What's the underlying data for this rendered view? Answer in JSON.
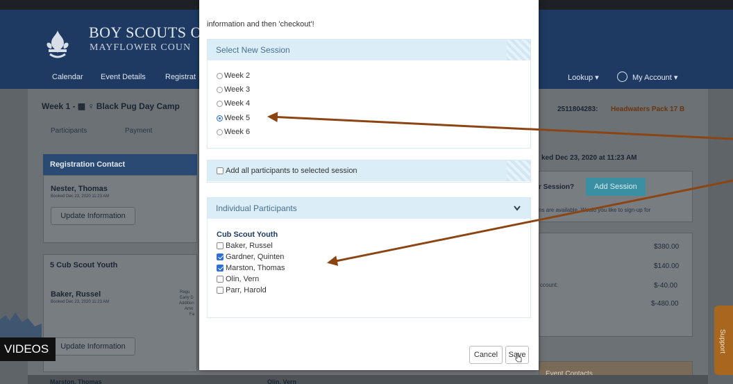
{
  "background_page": {
    "brand": {
      "line1": "BOY SCOUTS O",
      "line2": "MAYFLOWER COUN"
    },
    "nav": [
      "Calendar",
      "Event Details",
      "Registrat"
    ],
    "nav_right": {
      "lookup": "Lookup ▾",
      "account": "My Account ▾"
    },
    "event_title": "Week 1 - ▦ ♀ Black Pug Day Camp",
    "event_ref": "2511804283:",
    "event_ref_name": "Headwaters Pack 17 B",
    "tabs": [
      "Participants",
      "Payment"
    ],
    "registration_contact": {
      "heading": "Registration Contact",
      "name": "Nester, Thomas",
      "booked": "Booked Dec 23, 2020 11:23 AM",
      "update_button": "Update Information"
    },
    "booked_text": "ked Dec 23, 2020 at 11:23 AM",
    "session_question": "r Session?",
    "add_session_button": "Add Session",
    "available_text": "ns are available. Would you like to sign-up for",
    "youth_panel": {
      "heading": "5 Cub Scout Youth",
      "name": "Baker, Russel",
      "booked": "Booked Dec 23, 2020 11:23 AM",
      "fee_labels": [
        "Regu",
        "Early D",
        "Addition",
        "Amo",
        "Fa"
      ],
      "update_button": "Update Information"
    },
    "prices": [
      "$380.00",
      "$140.00",
      "$-40.00",
      "$-480.00"
    ],
    "discount_label": "ccount:",
    "event_contacts": "Event Contacts",
    "bottom_names": [
      "Marston, Thomas",
      "Olin, Vern"
    ],
    "videos_label": "VIDEOS",
    "support_label": "Support"
  },
  "modal": {
    "intro": "information and then 'checkout'!",
    "select_session": {
      "heading": "Select New Session",
      "options": [
        {
          "label": "Week 2",
          "selected": false
        },
        {
          "label": "Week 3",
          "selected": false
        },
        {
          "label": "Week 4",
          "selected": false
        },
        {
          "label": "Week 5",
          "selected": true
        },
        {
          "label": "Week 6",
          "selected": false
        }
      ]
    },
    "add_all": {
      "label": "Add all participants to selected session",
      "checked": false
    },
    "individual": {
      "heading": "Individual Participants",
      "group": "Cub Scout Youth",
      "participants": [
        {
          "name": "Baker, Russel",
          "checked": false
        },
        {
          "name": "Gardner, Quinten",
          "checked": true
        },
        {
          "name": "Marston, Thomas",
          "checked": true
        },
        {
          "name": "Olin, Vern",
          "checked": false
        },
        {
          "name": "Parr, Harold",
          "checked": false
        }
      ]
    },
    "buttons": {
      "cancel": "Cancel",
      "save": "Save"
    }
  },
  "colors": {
    "header_blue": "#1e3a63",
    "accent_blue": "#2c6fd6",
    "section_header": "#dbeef8",
    "arrow": "#8b4513",
    "teal_button": "#3a8fa3",
    "support_tab": "#a8661e"
  }
}
